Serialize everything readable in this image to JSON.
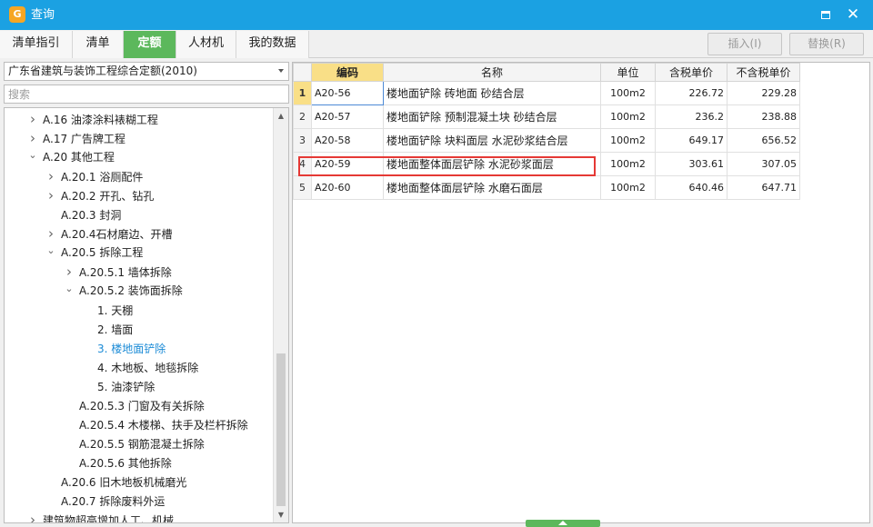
{
  "window": {
    "title": "查询",
    "logo_glyph": "G",
    "logo_color": "#f6a623",
    "titlebar_color": "#1ba1e2",
    "maximize_icon": "maximize-icon",
    "close_icon": "close-icon",
    "close_glyph": "✕"
  },
  "tabs": [
    {
      "label": "清单指引",
      "active": false
    },
    {
      "label": "清单",
      "active": false
    },
    {
      "label": "定额",
      "active": true
    },
    {
      "label": "人材机",
      "active": false
    },
    {
      "label": "我的数据",
      "active": false
    }
  ],
  "toolbar": {
    "insert_label": "插入(I)",
    "replace_label": "替换(R)"
  },
  "filter": {
    "selected_quota": "广东省建筑与装饰工程综合定额(2010)",
    "search_placeholder": "搜索"
  },
  "tree": [
    {
      "label": "A.16 油漆涂料裱糊工程",
      "level": 1,
      "chevron": "collapsed",
      "selected": false
    },
    {
      "label": "A.17 广告牌工程",
      "level": 1,
      "chevron": "collapsed",
      "selected": false
    },
    {
      "label": "A.20 其他工程",
      "level": 1,
      "chevron": "expanded",
      "selected": false
    },
    {
      "label": "A.20.1 浴厕配件",
      "level": 2,
      "chevron": "collapsed",
      "selected": false
    },
    {
      "label": "A.20.2 开孔、钻孔",
      "level": 2,
      "chevron": "collapsed",
      "selected": false
    },
    {
      "label": "A.20.3 封洞",
      "level": 2,
      "chevron": "none",
      "selected": false
    },
    {
      "label": "A.20.4石材磨边、开槽",
      "level": 2,
      "chevron": "collapsed",
      "selected": false
    },
    {
      "label": "A.20.5 拆除工程",
      "level": 2,
      "chevron": "expanded",
      "selected": false
    },
    {
      "label": "A.20.5.1 墙体拆除",
      "level": 3,
      "chevron": "collapsed",
      "selected": false
    },
    {
      "label": "A.20.5.2 装饰面拆除",
      "level": 3,
      "chevron": "expanded",
      "selected": false
    },
    {
      "label": "1. 天棚",
      "level": 4,
      "chevron": "none",
      "selected": false
    },
    {
      "label": "2. 墙面",
      "level": 4,
      "chevron": "none",
      "selected": false
    },
    {
      "label": "3. 楼地面铲除",
      "level": 4,
      "chevron": "none",
      "selected": true
    },
    {
      "label": "4. 木地板、地毯拆除",
      "level": 4,
      "chevron": "none",
      "selected": false
    },
    {
      "label": "5. 油漆铲除",
      "level": 4,
      "chevron": "none",
      "selected": false
    },
    {
      "label": "A.20.5.3 门窗及有关拆除",
      "level": 3,
      "chevron": "none",
      "selected": false
    },
    {
      "label": "A.20.5.4 木楼梯、扶手及栏杆拆除",
      "level": 3,
      "chevron": "none",
      "selected": false
    },
    {
      "label": "A.20.5.5 钢筋混凝土拆除",
      "level": 3,
      "chevron": "none",
      "selected": false
    },
    {
      "label": "A.20.5.6 其他拆除",
      "level": 3,
      "chevron": "none",
      "selected": false
    },
    {
      "label": "A.20.6 旧木地板机械磨光",
      "level": 2,
      "chevron": "none",
      "selected": false
    },
    {
      "label": "A.20.7 拆除废料外运",
      "level": 2,
      "chevron": "none",
      "selected": false
    },
    {
      "label": "建筑物超高增加人工、机械",
      "level": 1,
      "chevron": "collapsed",
      "selected": false
    }
  ],
  "grid": {
    "columns": [
      "编码",
      "名称",
      "单位",
      "含税单价",
      "不含税单价"
    ],
    "rows": [
      {
        "no": "1",
        "code": "A20-56",
        "name": "楼地面铲除 砖地面 砂结合层",
        "unit": "100m2",
        "price_tax": "226.72",
        "price_notax": "229.28",
        "current": true
      },
      {
        "no": "2",
        "code": "A20-57",
        "name": "楼地面铲除 预制混凝土块 砂结合层",
        "unit": "100m2",
        "price_tax": "236.2",
        "price_notax": "238.88",
        "current": false
      },
      {
        "no": "3",
        "code": "A20-58",
        "name": "楼地面铲除 块料面层 水泥砂浆结合层",
        "unit": "100m2",
        "price_tax": "649.17",
        "price_notax": "656.52",
        "current": false
      },
      {
        "no": "4",
        "code": "A20-59",
        "name": "楼地面整体面层铲除 水泥砂浆面层",
        "unit": "100m2",
        "price_tax": "303.61",
        "price_notax": "307.05",
        "current": false
      },
      {
        "no": "5",
        "code": "A20-60",
        "name": "楼地面整体面层铲除 水磨石面层",
        "unit": "100m2",
        "price_tax": "640.46",
        "price_notax": "647.71",
        "current": false
      }
    ],
    "highlight_color": "#e53935",
    "highlighted_row": "4"
  },
  "colors": {
    "tab_active": "#5cb85c",
    "header_key": "#f9df87",
    "tree_selected_text": "#1a8ad6"
  }
}
